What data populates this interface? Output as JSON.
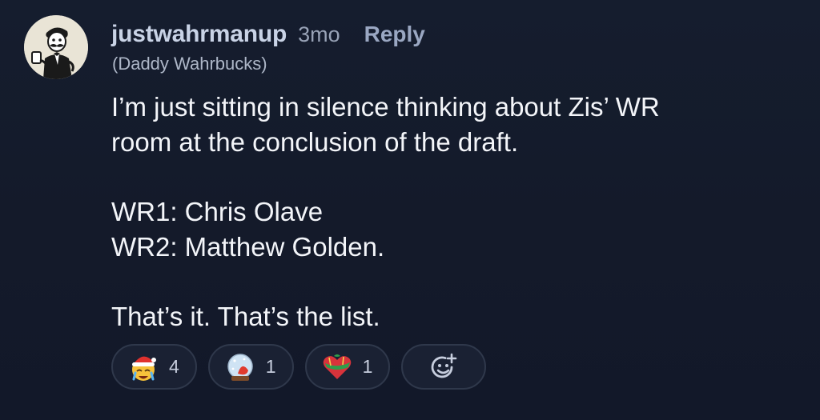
{
  "comment": {
    "username": "justwahrmanup",
    "timestamp": "3mo",
    "reply_label": "Reply",
    "flair": "(Daddy Wahrbucks)",
    "paragraphs": [
      "I’m just sitting in silence thinking about Zis’ WR\nroom at the conclusion of the draft.",
      "WR1: Chris Olave\nWR2: Matthew Golden.",
      "That’s it. That’s the list."
    ]
  },
  "reactions": [
    {
      "icon": "crying-santa-emoji-icon",
      "count": "4"
    },
    {
      "icon": "snow-globe-emoji-icon",
      "count": "1"
    },
    {
      "icon": "gift-wrapped-heart-emoji-icon",
      "count": "1"
    }
  ],
  "add_reaction": {
    "icon": "add-emoji-icon"
  },
  "colors": {
    "background": "#141a2a",
    "username": "#c9d3e6",
    "text": "#f3f5f9",
    "pill_border": "#2f384b"
  }
}
